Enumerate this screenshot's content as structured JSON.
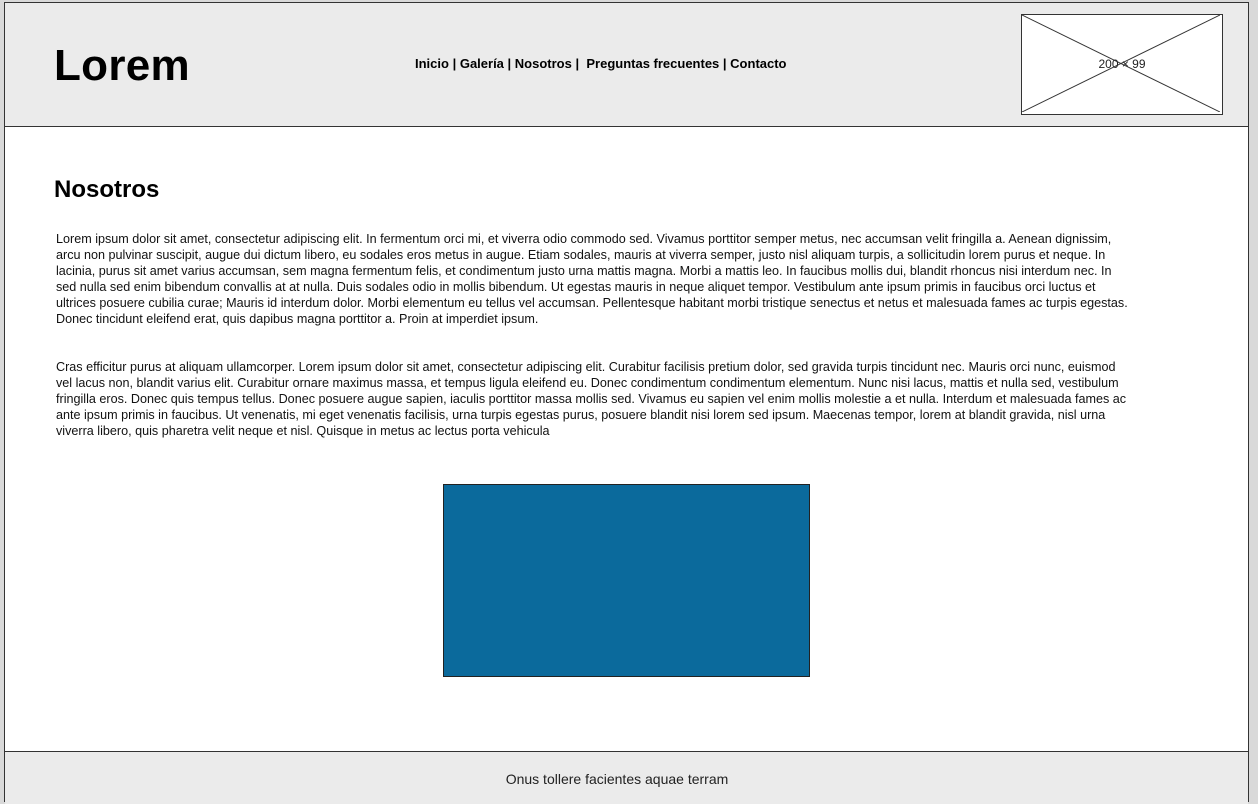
{
  "header": {
    "logo": "Lorem",
    "nav": [
      {
        "label": "Inicio"
      },
      {
        "label": "Galería"
      },
      {
        "label": "Nosotros"
      },
      {
        "label": "Preguntas frecuentes"
      },
      {
        "label": "Contacto"
      }
    ],
    "nav_separator": " | ",
    "image_placeholder": "200 × 99"
  },
  "main": {
    "title": "Nosotros",
    "paragraph_1": "Lorem ipsum dolor sit amet, consectetur adipiscing elit. In fermentum orci mi, et viverra odio commodo sed. Vivamus porttitor semper metus, nec accumsan velit fringilla a. Aenean dignissim, arcu non pulvinar suscipit, augue dui dictum libero, eu sodales eros metus in augue. Etiam sodales, mauris at viverra semper, justo nisl aliquam turpis, a sollicitudin lorem purus et neque. In lacinia, purus sit amet varius accumsan, sem magna fermentum felis, et condimentum justo urna mattis magna. Morbi a mattis leo. In faucibus mollis dui, blandit rhoncus nisi interdum nec. In sed nulla sed enim bibendum convallis at at nulla. Duis sodales odio in mollis bibendum. Ut egestas mauris in neque aliquet tempor. Vestibulum ante ipsum primis in faucibus orci luctus et ultrices posuere cubilia curae; Mauris id interdum dolor. Morbi elementum eu tellus vel accumsan. Pellentesque habitant morbi tristique senectus et netus et malesuada fames ac turpis egestas. Donec tincidunt eleifend erat, quis dapibus magna porttitor a. Proin at imperdiet ipsum.",
    "paragraph_2": "Cras efficitur purus at aliquam ullamcorper. Lorem ipsum dolor sit amet, consectetur adipiscing elit. Curabitur facilisis pretium dolor, sed gravida turpis tincidunt nec. Mauris orci nunc, euismod vel lacus non, blandit varius elit. Curabitur ornare maximus massa, et tempus ligula eleifend eu. Donec condimentum condimentum elementum. Nunc nisi lacus, mattis et nulla sed, vestibulum fringilla eros. Donec quis tempus tellus. Donec posuere augue sapien, iaculis porttitor massa mollis sed. Vivamus eu sapien vel enim mollis molestie a et nulla. Interdum et malesuada fames ac ante ipsum primis in faucibus. Ut venenatis, mi eget venenatis facilisis, urna turpis egestas purus, posuere blandit nisi lorem sed ipsum. Maecenas tempor, lorem at blandit gravida, nisl urna viverra libero, quis pharetra velit neque et nisl. Quisque in metus ac lectus porta vehicula"
  },
  "colors": {
    "header_bg": "#ebebeb",
    "media_block": "#0b6a9c"
  },
  "footer": {
    "text": "Onus tollere facientes aquae terram"
  }
}
